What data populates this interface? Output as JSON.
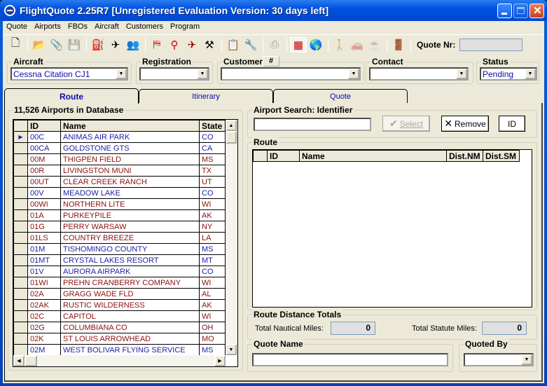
{
  "window": {
    "title": "FlightQuote 2.25R7 [Unregistered Evaluation Version: 30 days left]"
  },
  "menu": [
    "Quote",
    "Airports",
    "FBOs",
    "Aircraft",
    "Customers",
    "Program"
  ],
  "toolbar": {
    "icons": [
      "new-document-icon",
      "open-folder-icon",
      "attach-icon",
      "save-icon",
      "fuel-pump-icon",
      "aircraft-icon",
      "crew-icon",
      "airport-icon",
      "fuel-nozzle-icon",
      "aircraft-red-icon",
      "maintenance-icon",
      "form-icon",
      "wrench-icon",
      "print-icon",
      "us-map-icon",
      "globe-icon",
      "person-icon",
      "vehicle-icon",
      "catering-icon",
      "exit-door-icon"
    ],
    "quote_nr_label": "Quote Nr:",
    "quote_nr_value": ""
  },
  "fields": {
    "aircraft": {
      "label": "Aircraft",
      "value": "Cessna Citation CJ1"
    },
    "registration": {
      "label": "Registration",
      "value": ""
    },
    "customer": {
      "label": "Customer",
      "hash_button": "#",
      "value": ""
    },
    "contact": {
      "label": "Contact",
      "value": ""
    },
    "status": {
      "label": "Status",
      "value": "Pending"
    }
  },
  "tabs": [
    {
      "label": "Route",
      "active": true
    },
    {
      "label": "Itinerary"
    },
    {
      "label": "Quote"
    }
  ],
  "airports": {
    "title": "11,526 Airports in Database",
    "columns": [
      "ID",
      "Name",
      "State"
    ],
    "rows": [
      [
        "00C",
        "ANIMAS AIR PARK",
        "CO",
        "blue"
      ],
      [
        "00CA",
        "GOLDSTONE GTS",
        "CA",
        "blue"
      ],
      [
        "00M",
        "THIGPEN FIELD",
        "MS",
        "red"
      ],
      [
        "00R",
        "LIVINGSTON MUNI",
        "TX",
        "red"
      ],
      [
        "00UT",
        "CLEAR CREEK RANCH",
        "UT",
        "red"
      ],
      [
        "00V",
        "MEADOW LAKE",
        "CO",
        "blue"
      ],
      [
        "00WI",
        "NORTHERN  LITE",
        "WI",
        "red"
      ],
      [
        "01A",
        "PURKEYPILE",
        "AK",
        "red"
      ],
      [
        "01G",
        "PERRY WARSAW",
        "NY",
        "red"
      ],
      [
        "01LS",
        "COUNTRY BREEZE",
        "LA",
        "red"
      ],
      [
        "01M",
        "TISHOMINGO COUNTY",
        "MS",
        "blue"
      ],
      [
        "01MT",
        "CRYSTAL LAKES RESORT",
        "MT",
        "blue"
      ],
      [
        "01V",
        "AURORA AIRPARK",
        "CO",
        "blue"
      ],
      [
        "01WI",
        "PREHN CRANBERRY COMPANY",
        "WI",
        "red"
      ],
      [
        "02A",
        "GRAGG WADE FLD",
        "AL",
        "red"
      ],
      [
        "02AK",
        "RUSTIC WILDERNESS",
        "AK",
        "red"
      ],
      [
        "02C",
        "CAPITOL",
        "WI",
        "red"
      ],
      [
        "02G",
        "COLUMBIANA CO",
        "OH",
        "red"
      ],
      [
        "02K",
        "ST LOUIS ARROWHEAD",
        "MO",
        "red"
      ],
      [
        "02M",
        "WEST BOLIVAR FLYING SERVICE",
        "MS",
        "blue"
      ]
    ]
  },
  "search": {
    "label": "Airport Search: Identifier",
    "value": "",
    "select_label": "Select",
    "remove_label": "Remove",
    "id_label": "ID"
  },
  "route": {
    "label": "Route",
    "columns": [
      "ID",
      "Name",
      "Dist.NM",
      "Dist.SM"
    ]
  },
  "totals": {
    "label": "Route Distance Totals",
    "nm_label": "Total Nautical Miles:",
    "nm_value": "0",
    "sm_label": "Total Statute Miles:",
    "sm_value": "0"
  },
  "quote_name": {
    "label": "Quote Name",
    "value": ""
  },
  "quoted_by": {
    "label": "Quoted By",
    "value": ""
  }
}
